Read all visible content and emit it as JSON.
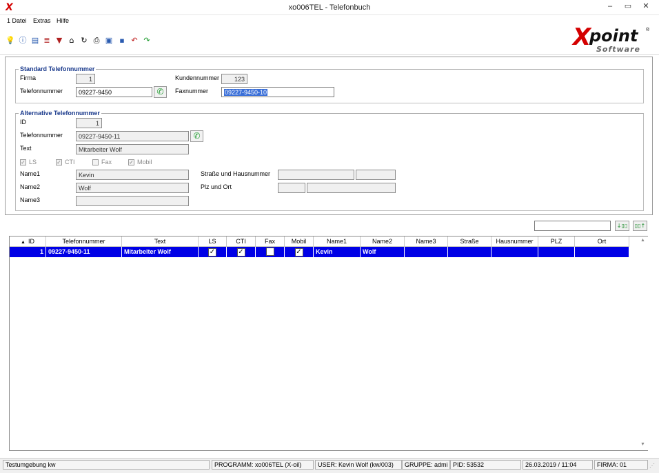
{
  "window": {
    "title": "xo006TEL - Telefonbuch",
    "app_icon": "X"
  },
  "menu": [
    "1 Datei",
    "Extras",
    "Hilfe"
  ],
  "toolbar_icons": [
    "lightbulb-icon",
    "info-icon",
    "book-icon",
    "database-icon",
    "filter-icon",
    "home-icon",
    "refresh-icon",
    "print-icon",
    "screen-icon",
    "save-icon",
    "undo-icon",
    "redo-icon"
  ],
  "brand": {
    "x": "X",
    "point": "point",
    "software": "Software",
    "reg": "®"
  },
  "standard": {
    "legend": "Standard Telefonnummer",
    "firma_label": "Firma",
    "firma_value": "1",
    "kundennummer_label": "Kundennummer",
    "kundennummer_value": "123",
    "telefon_label": "Telefonnummer",
    "telefon_value": "09227-9450",
    "fax_label": "Faxnummer",
    "fax_value": "09227-9450-10"
  },
  "alternative": {
    "legend": "Alternative Telefonnummer",
    "id_label": "ID",
    "id_value": "1",
    "telefon_label": "Telefonnummer",
    "telefon_value": "09227-9450-11",
    "text_label": "Text",
    "text_value": "Mitarbeiter Wolf",
    "checkboxes": [
      {
        "label": "LS",
        "checked": true
      },
      {
        "label": "CTI",
        "checked": true
      },
      {
        "label": "Fax",
        "checked": false
      },
      {
        "label": "Mobil",
        "checked": true
      }
    ],
    "name1_label": "Name1",
    "name1_value": "Kevin",
    "name2_label": "Name2",
    "name2_value": "Wolf",
    "name3_label": "Name3",
    "name3_value": "",
    "strasse_label": "Straße und Hausnummer",
    "plz_label": "Plz und Ort"
  },
  "grid": {
    "columns": [
      "ID",
      "Telefonnummer",
      "Text",
      "LS",
      "CTI",
      "Fax",
      "Mobil",
      "Name1",
      "Name2",
      "Name3",
      "Straße",
      "Hausnummer",
      "PLZ",
      "Ort"
    ],
    "rows": [
      {
        "ID": "1",
        "Telefonnummer": "09227-9450-11",
        "Text": "Mitarbeiter Wolf",
        "LS": true,
        "CTI": true,
        "Fax": false,
        "Mobil": true,
        "Name1": "Kevin",
        "Name2": "Wolf",
        "Name3": "",
        "Straße": "",
        "Hausnummer": "",
        "PLZ": "",
        "Ort": ""
      }
    ],
    "selected_row_color": "#0000e6"
  },
  "status": {
    "env": "Testumgebung kw",
    "programm": "PROGRAMM: xo006TEL (X-oil)",
    "user": "USER: Kevin Wolf (kw/003)",
    "gruppe": "GRUPPE: admi",
    "pid": "PID: 53532",
    "datetime": "26.03.2019 / 11:04",
    "firma": "FIRMA: 01"
  }
}
